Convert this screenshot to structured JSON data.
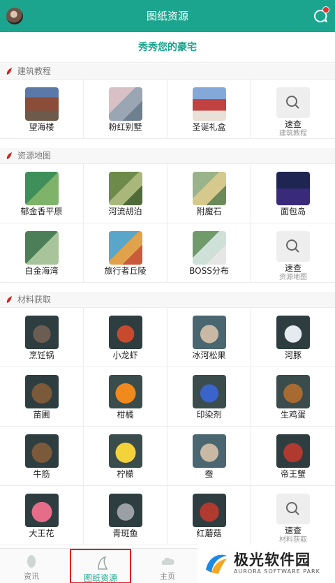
{
  "header": {
    "title": "图纸资源"
  },
  "promo": {
    "text": "秀秀您的豪宅"
  },
  "sections": [
    {
      "title": "建筑教程",
      "items": [
        {
          "label": "望海楼"
        },
        {
          "label": "粉红别墅"
        },
        {
          "label": "圣诞礼盒"
        },
        {
          "label": "速查",
          "sub": "建筑教程"
        }
      ]
    },
    {
      "title": "资源地图",
      "items": [
        {
          "label": "郁金香平原"
        },
        {
          "label": "河流胡泊"
        },
        {
          "label": "附魔石"
        },
        {
          "label": "面包岛"
        },
        {
          "label": "白金海湾"
        },
        {
          "label": "旅行者丘陵"
        },
        {
          "label": "BOSS分布"
        },
        {
          "label": "速查",
          "sub": "资源地图"
        }
      ]
    },
    {
      "title": "材料获取",
      "items": [
        {
          "label": "烹饪锅"
        },
        {
          "label": "小龙虾"
        },
        {
          "label": "冰河松果"
        },
        {
          "label": "河豚"
        },
        {
          "label": "苗圃"
        },
        {
          "label": "柑橘"
        },
        {
          "label": "印染剂"
        },
        {
          "label": "生鸡蛋"
        },
        {
          "label": "牛筋"
        },
        {
          "label": "柠檬"
        },
        {
          "label": "蚕"
        },
        {
          "label": "帝王蟹"
        },
        {
          "label": "大王花"
        },
        {
          "label": "青斑鱼"
        },
        {
          "label": "红蘑菇"
        },
        {
          "label": "速查",
          "sub": "材料获取"
        }
      ]
    }
  ],
  "bottom_nav": [
    {
      "label": "资讯"
    },
    {
      "label": "图纸资源"
    },
    {
      "label": "主页"
    }
  ],
  "watermark": {
    "title": "极光软件园",
    "subtitle": "AURORA SOFTWARE PARK"
  },
  "colors": {
    "accent": "#1ba58e",
    "highlight_border": "#e02020",
    "badge": "#e8312f"
  }
}
